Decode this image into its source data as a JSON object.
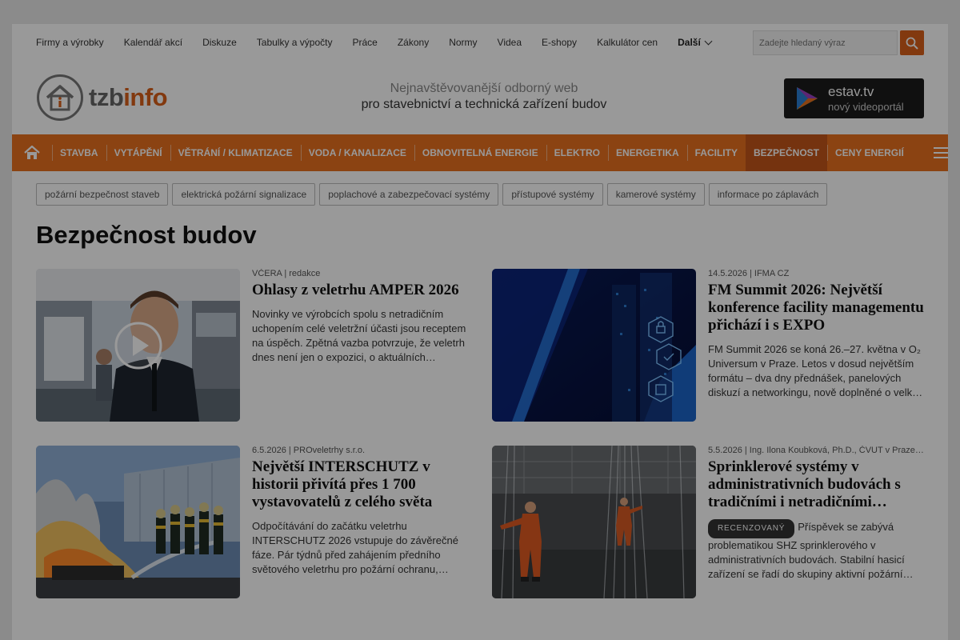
{
  "top_links": [
    "Firmy a výrobky",
    "Kalendář akcí",
    "Diskuze",
    "Tabulky a výpočty",
    "Práce",
    "Zákony",
    "Normy",
    "Videa",
    "E-shopy",
    "Kalkulátor cen"
  ],
  "top_more_label": "Další",
  "search": {
    "placeholder": "Zadejte hledaný výraz"
  },
  "logo": {
    "part1": "tzb",
    "part2": "info"
  },
  "tagline": {
    "line1": "Nejnavštěvovanější odborný web",
    "line2": "pro stavebnictví a technická zařízení budov"
  },
  "estav": {
    "title": "estav.tv",
    "subtitle": "nový videoportál"
  },
  "nav": [
    "STAVBA",
    "VYTÁPĚNÍ",
    "VĚTRÁNÍ / KLIMATIZACE",
    "VODA / KANALIZACE",
    "OBNOVITELNÁ ENERGIE",
    "ELEKTRO",
    "ENERGETIKA",
    "FACILITY",
    "BEZPEČNOST",
    "CENY ENERGIÍ"
  ],
  "nav_active": "BEZPEČNOST",
  "tags": [
    "požární bezpečnost staveb",
    "elektrická požární signalizace",
    "poplachové a zabezpečovací systémy",
    "přístupové systémy",
    "kamerové systémy",
    "informace po záplavách"
  ],
  "page_title": "Bezpečnost budov",
  "articles": [
    {
      "meta": "VČERA | redakce",
      "title": "Ohlasy z veletrhu AMPER 2026",
      "perex": "Novinky ve výrobcích spolu s netradičním uchopením celé veletržní účasti jsou receptem na úspěch. Zpětná vazba potvrzuje, že veletrh dnes není jen o expozici, o aktuálních…",
      "badge": ""
    },
    {
      "meta": "14.5.2026 | IFMA CZ",
      "title": "FM Summit 2026: Největší konference facility managementu přichází i s EXPO",
      "perex": "FM Summit 2026 se koná 26.–27. května v O₂ Universum v Praze. Letos v dosud největším formátu – dva dny přednášek, panelových diskuzí a networkingu, nově doplněné o velk…",
      "badge": ""
    },
    {
      "meta": "6.5.2026 | PROveletrhy s.r.o.",
      "title": "Největší INTERSCHUTZ v historii přivítá přes 1 700 vystavovatelů z celého světa",
      "perex": "Odpočítávání do začátku veletrhu INTERSCHUTZ 2026 vstupuje do závěrečné fáze. Pár týdnů před zahájením předního světového veletrhu pro požární ochranu,…",
      "badge": ""
    },
    {
      "meta": "5.5.2026 | Ing. Ilona Koubková, Ph.D., ČVUT v Praze…",
      "title": "Sprinklerové systémy v administrativních budovách s tradičními i netradičními…",
      "perex": "Příspěvek se zabývá problematikou SHZ sprinklerového v administrativních budovách. Stabilní hasicí zařízení se řadí do skupiny aktivní požární…",
      "badge": "RECENZOVANÝ"
    }
  ],
  "colors": {
    "accent": "#e8701e",
    "active_nav": "#c4561a",
    "search_button": "#d9601a"
  }
}
